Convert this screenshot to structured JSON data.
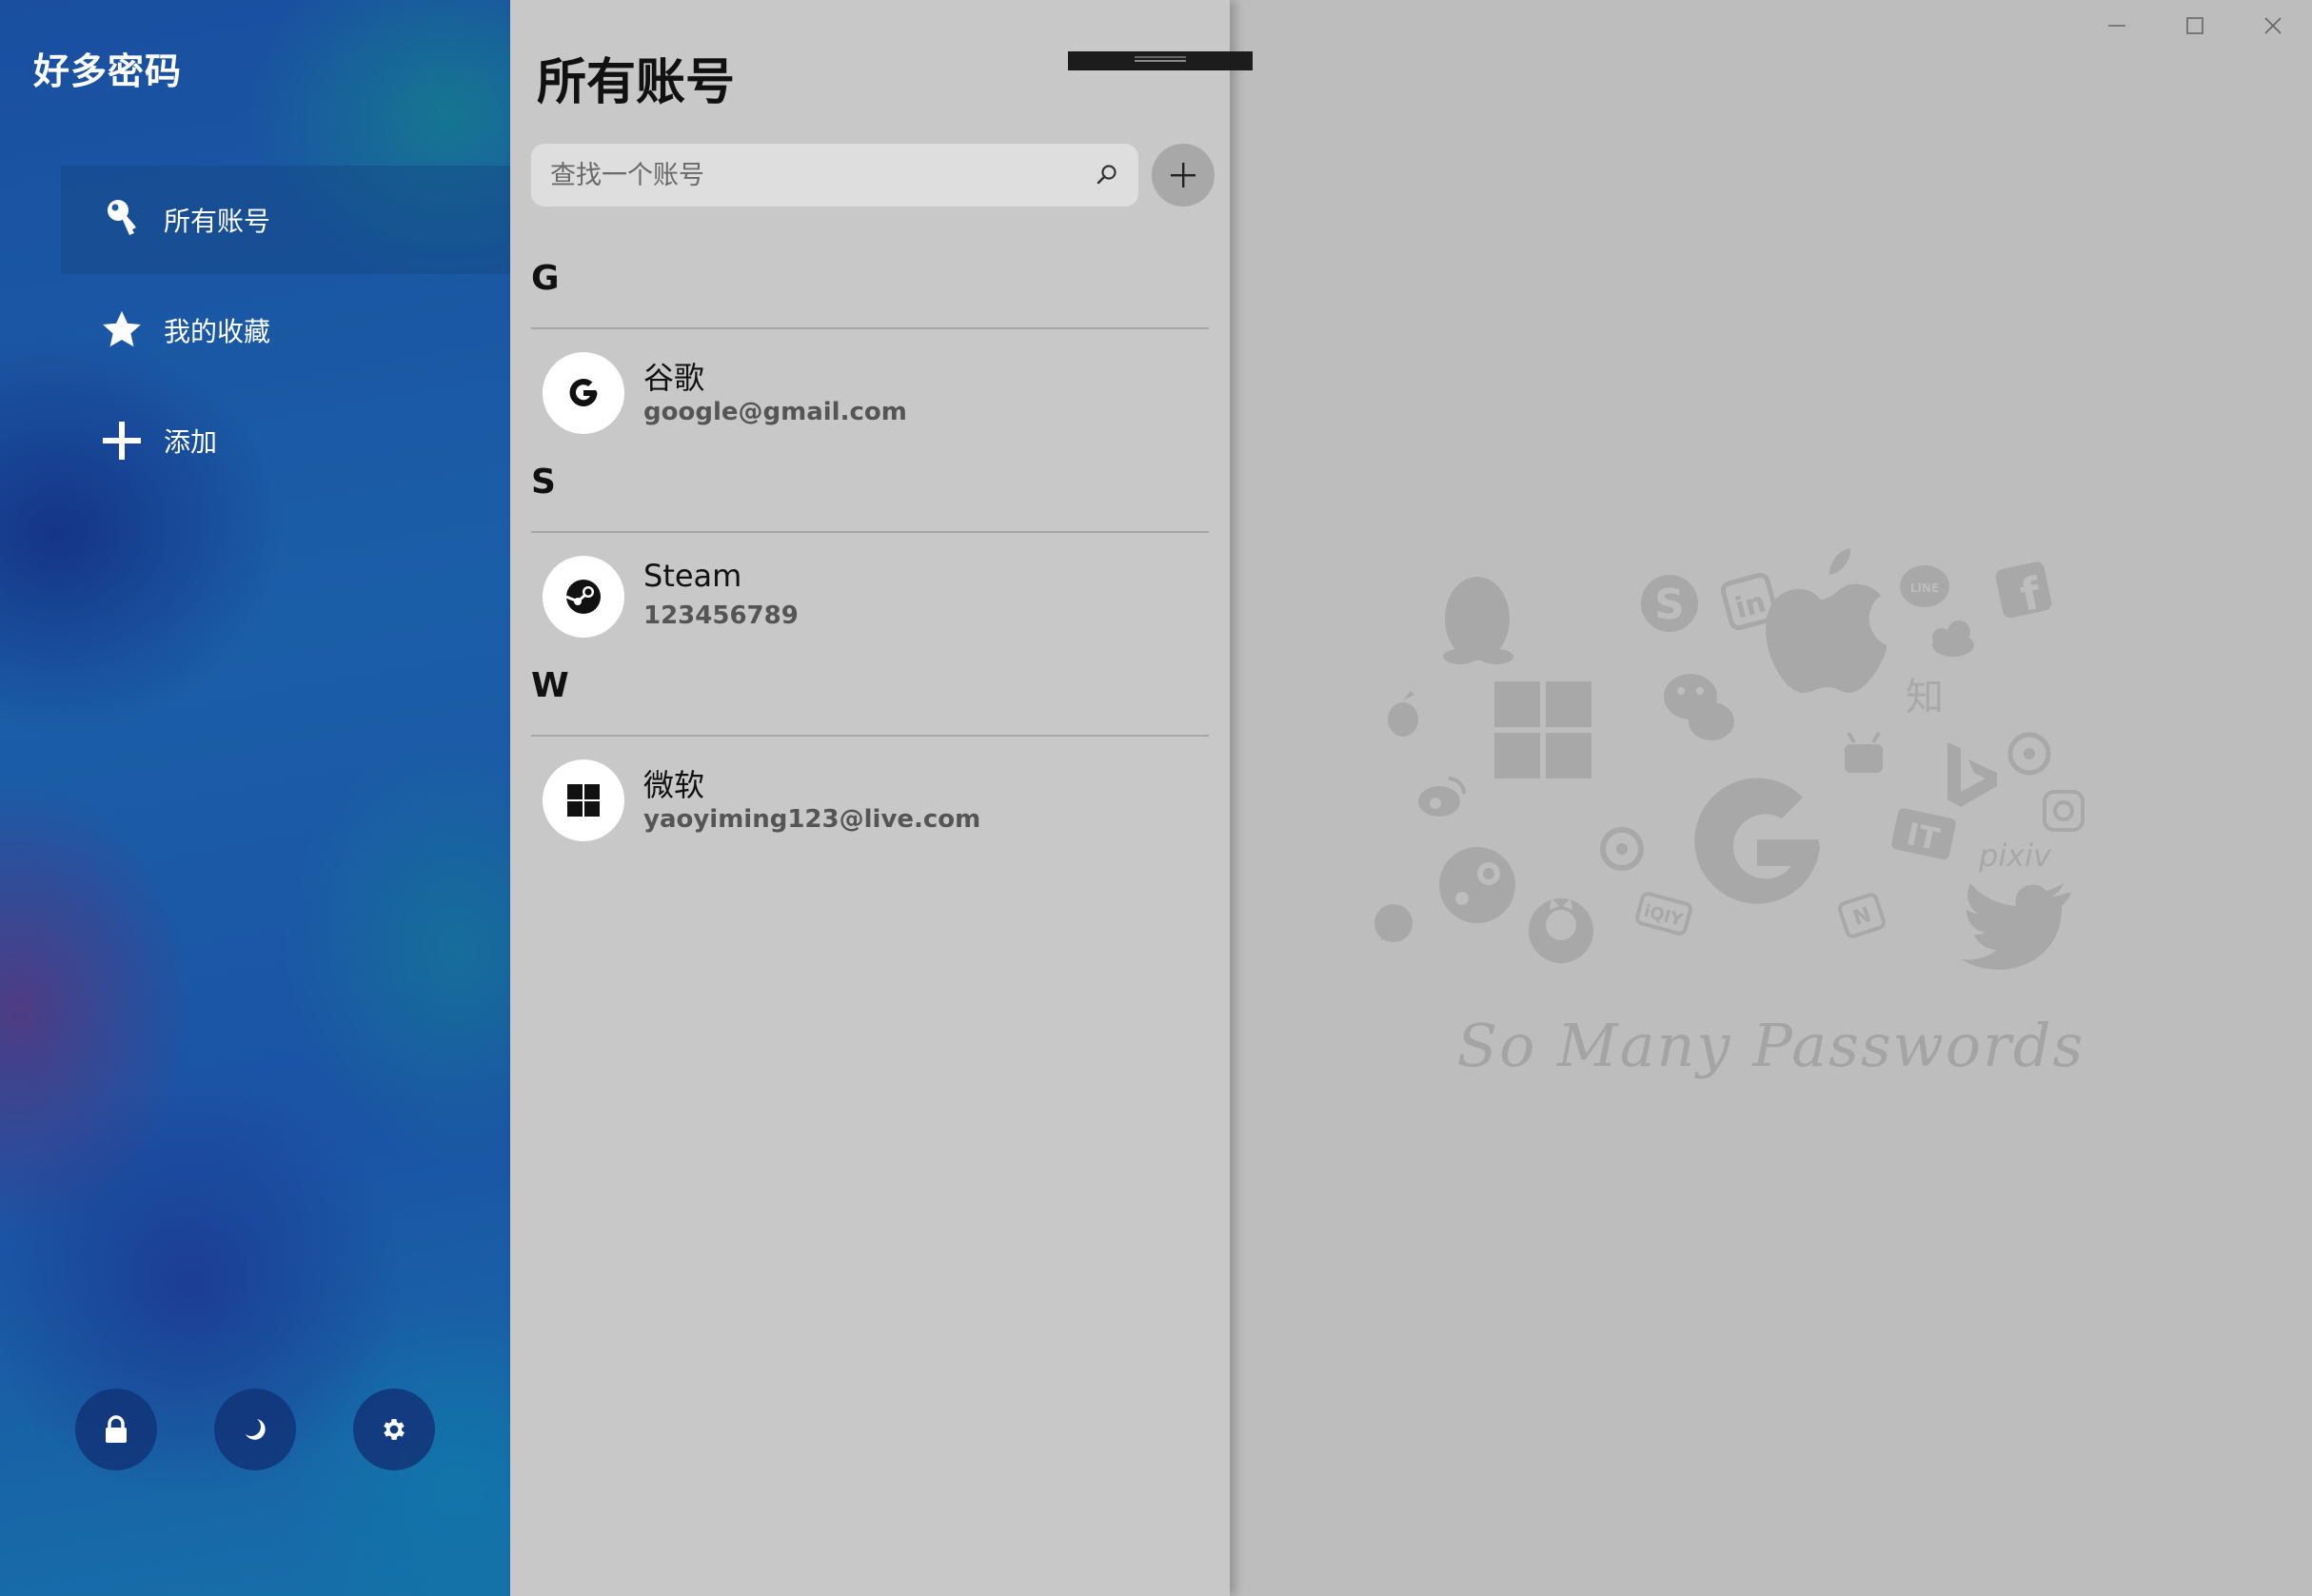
{
  "app": {
    "title": "好多密码"
  },
  "sidebar": {
    "items": [
      {
        "label": "所有账号",
        "icon": "key-icon",
        "active": true
      },
      {
        "label": "我的收藏",
        "icon": "star-icon",
        "active": false
      },
      {
        "label": "添加",
        "icon": "plus-icon",
        "active": false
      }
    ],
    "bottom_buttons": [
      {
        "icon": "lock-icon"
      },
      {
        "icon": "moon-icon"
      },
      {
        "icon": "gear-icon"
      }
    ]
  },
  "list": {
    "title": "所有账号",
    "search": {
      "placeholder": "查找一个账号",
      "value": ""
    },
    "groups": [
      {
        "letter": "G",
        "accounts": [
          {
            "name": "谷歌",
            "username": "google@gmail.com",
            "icon": "google-icon"
          }
        ]
      },
      {
        "letter": "S",
        "accounts": [
          {
            "name": "Steam",
            "username": "123456789",
            "icon": "steam-icon"
          }
        ]
      },
      {
        "letter": "W",
        "accounts": [
          {
            "name": "微软",
            "username": "yaoyiming123@live.com",
            "icon": "windows-icon"
          }
        ]
      }
    ]
  },
  "detail": {
    "slogan": "So Many Passwords",
    "art_words": {
      "zhi": "知",
      "pixiv": "pixiv",
      "line": "LINE",
      "iqiyi": "iQIY"
    }
  },
  "colors": {
    "sidebar_accent": "#1b5ea8",
    "list_bg": "#c8c8c8",
    "detail_bg": "#bdbdbd",
    "art_gray": "#a6a6a6"
  }
}
